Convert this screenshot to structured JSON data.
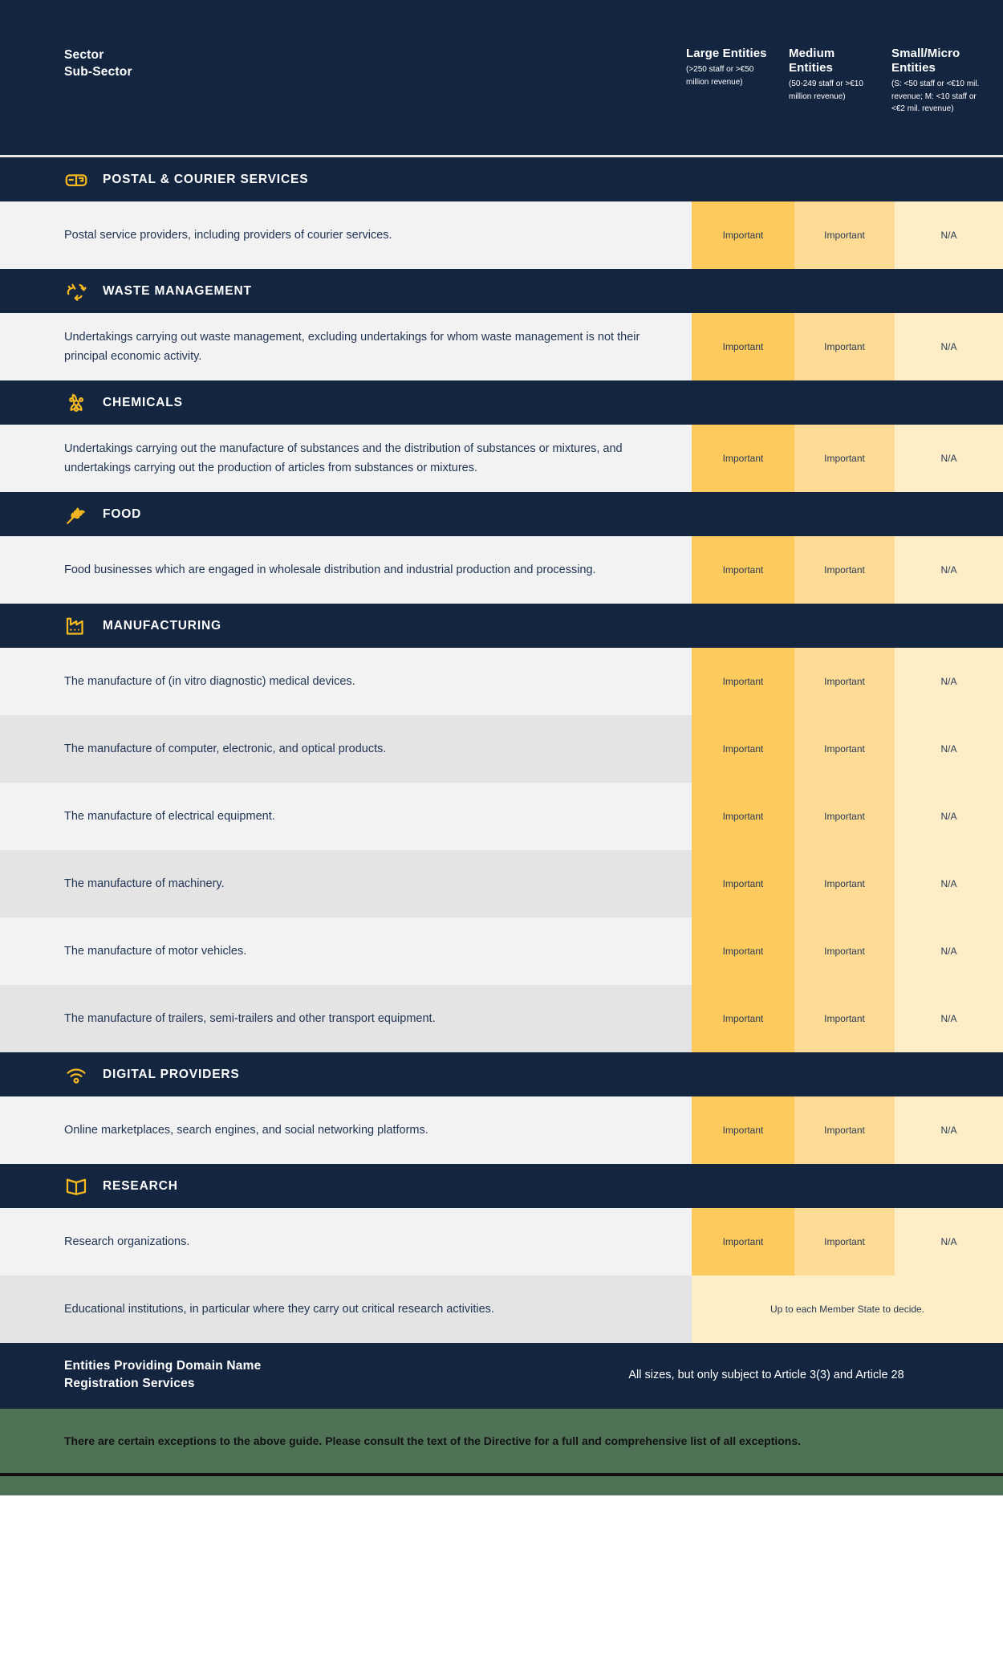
{
  "header": {
    "left_line1": "Sector",
    "left_line2": "Sub-Sector",
    "columns": [
      {
        "title": "Large Entities",
        "sub": "(>250 staff or >€50 million revenue)"
      },
      {
        "title": "Medium Entities",
        "sub": "(50-249 staff or >€10 million revenue)"
      },
      {
        "title": "Small/Micro Entities",
        "sub": "(S: <50 staff or <€10 mil. revenue; M: <10 staff or <€2 mil. revenue)"
      }
    ]
  },
  "colors": {
    "navy": "#13253f",
    "large_cell": "#fdcb5d",
    "medium_cell": "#fddb95",
    "small_cell": "#fdeec7",
    "row_light": "#f2f2f2",
    "row_alt": "#e4e4e4",
    "green_band": "#4f7257",
    "icon_gold": "#f5b820"
  },
  "sections": [
    {
      "title": "Postal & Courier Services",
      "icon": "mailbox-icon",
      "rows": [
        {
          "desc": "Postal service providers, including providers of courier services.",
          "large": "Important",
          "medium": "Important",
          "small": "N/A"
        }
      ]
    },
    {
      "title": "Waste Management",
      "icon": "recycle-icon",
      "rows": [
        {
          "desc": "Undertakings carrying out waste management, excluding undertakings for whom waste management is not their principal economic activity.",
          "large": "Important",
          "medium": "Important",
          "small": "N/A"
        }
      ]
    },
    {
      "title": "Chemicals",
      "icon": "biohazard-icon",
      "rows": [
        {
          "desc": "Undertakings carrying out the manufacture of substances and the distribution of substances or mixtures, and undertakings carrying out the production of articles from substances or mixtures.",
          "large": "Important",
          "medium": "Important",
          "small": "N/A"
        }
      ]
    },
    {
      "title": "Food",
      "icon": "wheat-icon",
      "rows": [
        {
          "desc": "Food businesses which are engaged in wholesale distribution and industrial production and processing.",
          "large": "Important",
          "medium": "Important",
          "small": "N/A"
        }
      ]
    },
    {
      "title": "Manufacturing",
      "icon": "factory-icon",
      "rows": [
        {
          "desc": "The manufacture of (in vitro diagnostic) medical devices.",
          "large": "Important",
          "medium": "Important",
          "small": "N/A"
        },
        {
          "desc": "The manufacture of computer, electronic, and optical products.",
          "large": "Important",
          "medium": "Important",
          "small": "N/A"
        },
        {
          "desc": "The manufacture of electrical equipment.",
          "large": "Important",
          "medium": "Important",
          "small": "N/A"
        },
        {
          "desc": "The manufacture of machinery.",
          "large": "Important",
          "medium": "Important",
          "small": "N/A"
        },
        {
          "desc": "The manufacture of motor vehicles.",
          "large": "Important",
          "medium": "Important",
          "small": "N/A"
        },
        {
          "desc": "The manufacture of trailers, semi-trailers and other transport equipment.",
          "large": "Important",
          "medium": "Important",
          "small": "N/A"
        }
      ]
    },
    {
      "title": "Digital Providers",
      "icon": "wifi-icon",
      "rows": [
        {
          "desc": "Online marketplaces, search engines, and social networking platforms.",
          "large": "Important",
          "medium": "Important",
          "small": "N/A"
        }
      ]
    },
    {
      "title": "Research",
      "icon": "book-icon",
      "rows": [
        {
          "desc": "Research organizations.",
          "large": "Important",
          "medium": "Important",
          "small": "N/A"
        },
        {
          "desc": "Educational institutions, in particular where they carry out critical research activities.",
          "merged": "Up to each Member State to decide."
        }
      ]
    }
  ],
  "domain_footer": {
    "label_line1": "Entities Providing Domain Name",
    "label_line2": "Registration Services",
    "note": "All sizes, but only subject to Article 3(3) and Article 28"
  },
  "note_band": {
    "text": "There are certain exceptions to the above guide. Please consult the text of the Directive for a full and comprehensive list of all exceptions."
  }
}
